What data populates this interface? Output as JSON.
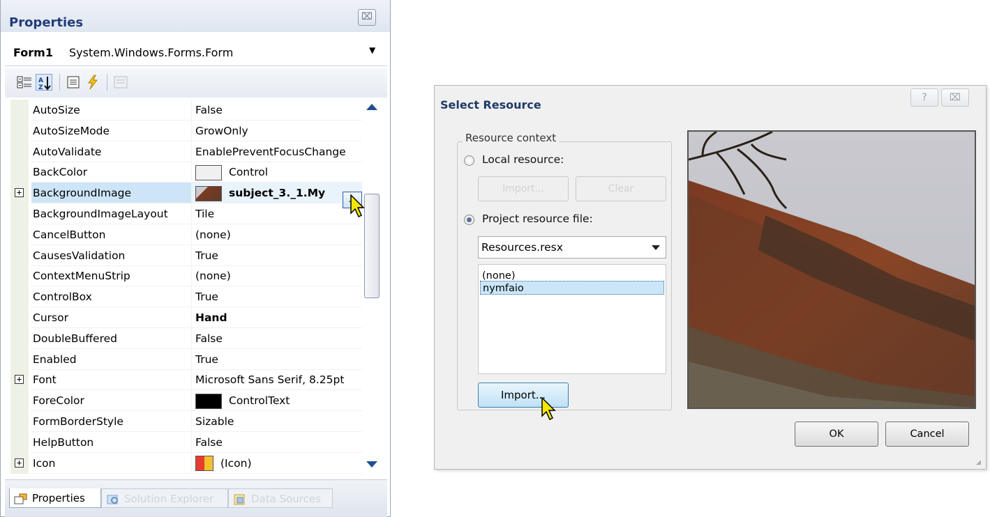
{
  "properties_panel": {
    "title": "Properties",
    "close_glyph": "⌧",
    "object_name": "Form1",
    "object_type": "System.Windows.Forms.Form",
    "toolbar_icons": [
      "categorized-icon",
      "alphabetical-icon",
      "properties-icon",
      "events-icon",
      "property-pages-icon"
    ],
    "rows": [
      {
        "name": "AutoSize",
        "value": "False"
      },
      {
        "name": "AutoSizeMode",
        "value": "GrowOnly"
      },
      {
        "name": "AutoValidate",
        "value": "EnablePreventFocusChange"
      },
      {
        "name": "BackColor",
        "value": "Control",
        "swatch": "#f0f0f0"
      },
      {
        "name": "BackgroundImage",
        "value": "subject_3._1.My",
        "bold": true,
        "expand": true,
        "selected": true
      },
      {
        "name": "BackgroundImageLayout",
        "value": "Tile"
      },
      {
        "name": "CancelButton",
        "value": "(none)"
      },
      {
        "name": "CausesValidation",
        "value": "True"
      },
      {
        "name": "ContextMenuStrip",
        "value": "(none)"
      },
      {
        "name": "ControlBox",
        "value": "True"
      },
      {
        "name": "Cursor",
        "value": "Hand",
        "bold": true
      },
      {
        "name": "DoubleBuffered",
        "value": "False"
      },
      {
        "name": "Enabled",
        "value": "True"
      },
      {
        "name": "Font",
        "value": "Microsoft Sans Serif, 8.25pt",
        "expand": true
      },
      {
        "name": "ForeColor",
        "value": "ControlText",
        "swatch": "#000000"
      },
      {
        "name": "FormBorderStyle",
        "value": "Sizable"
      },
      {
        "name": "HelpButton",
        "value": "False"
      },
      {
        "name": "Icon",
        "value": "(Icon)",
        "expand": true
      }
    ],
    "ellipsis_label": "...",
    "bottom_tabs": [
      "Properties",
      "Solution Explorer",
      "Data Sources"
    ]
  },
  "select_resource": {
    "title": "Select Resource",
    "help_glyph": "?",
    "close_glyph": "⌧",
    "group_label": "Resource context",
    "local_resource_label": "Local resource:",
    "local_import_label": "Import...",
    "local_clear_label": "Clear",
    "project_resource_label": "Project resource file:",
    "project_file_selected": "Resources.resx",
    "resource_list": [
      "(none)",
      "nymfaio"
    ],
    "selected_resource": "nymfaio",
    "import_label": "Import...",
    "ok_label": "OK",
    "cancel_label": "Cancel"
  },
  "colors": {
    "selection": "#cde5f7",
    "title_text": "#233c7a",
    "import_button": "#bfe1f5"
  }
}
